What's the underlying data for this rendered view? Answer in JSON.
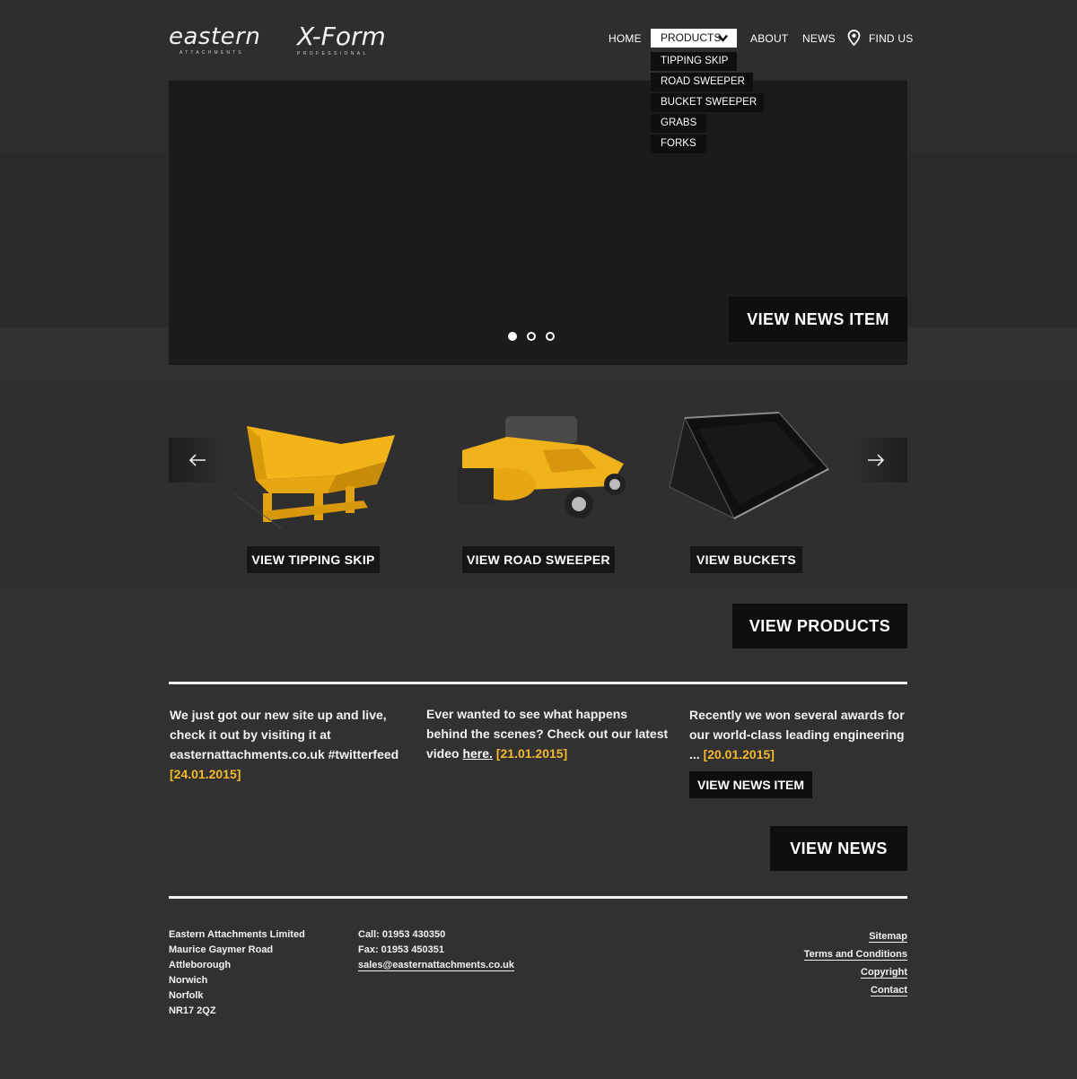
{
  "brand": {
    "eastern_name": "eastern",
    "eastern_sub": "ATTACHMENTS",
    "xform_name": "X-Form",
    "xform_sub": "PROFESSIONAL"
  },
  "nav": {
    "home": "HOME",
    "products": "PRODUCTS",
    "about": "ABOUT",
    "news": "NEWS",
    "find_us": "FIND US"
  },
  "products_menu": [
    "TIPPING SKIP",
    "ROAD SWEEPER",
    "BUCKET SWEEPER",
    "GRABS",
    "FORKS"
  ],
  "hero": {
    "button": "VIEW NEWS ITEM",
    "slides_total": 3,
    "active_slide": 1
  },
  "carousel": {
    "items": [
      {
        "label": "VIEW TIPPING SKIP"
      },
      {
        "label": "VIEW ROAD SWEEPER"
      },
      {
        "label": "VIEW BUCKETS"
      }
    ],
    "view_products": "VIEW PRODUCTS"
  },
  "news": {
    "items": [
      {
        "text": "We just got our new site up and live, check it out by visiting it at easternattachments.co.uk #twitterfeed",
        "date": "[24.01.2015]"
      },
      {
        "text": "Ever wanted to see what happens behind the scenes? Check out our latest video",
        "link": "here.",
        "date": "[21.01.2015]"
      },
      {
        "text": "Recently we won several awards for our world-class leading engineering ...",
        "date": "[20.01.2015]",
        "button": "VIEW NEWS ITEM"
      }
    ],
    "view_news": "VIEW NEWS"
  },
  "footer": {
    "address": [
      "Eastern Attachments Limited",
      "Maurice Gaymer Road",
      "Attleborough",
      "Norwich",
      "Norfolk",
      "NR17 2QZ"
    ],
    "call": "Call: 01953 430350",
    "fax": "Fax: 01953 450351",
    "email": "sales@easternattachments.co.uk",
    "links": [
      "Sitemap",
      "Terms and Conditions",
      "Copyright",
      "Contact"
    ]
  },
  "colors": {
    "page_bg": "#313131",
    "accent_yellow": "#f5b92e",
    "button_black": "#0e0e0e"
  }
}
